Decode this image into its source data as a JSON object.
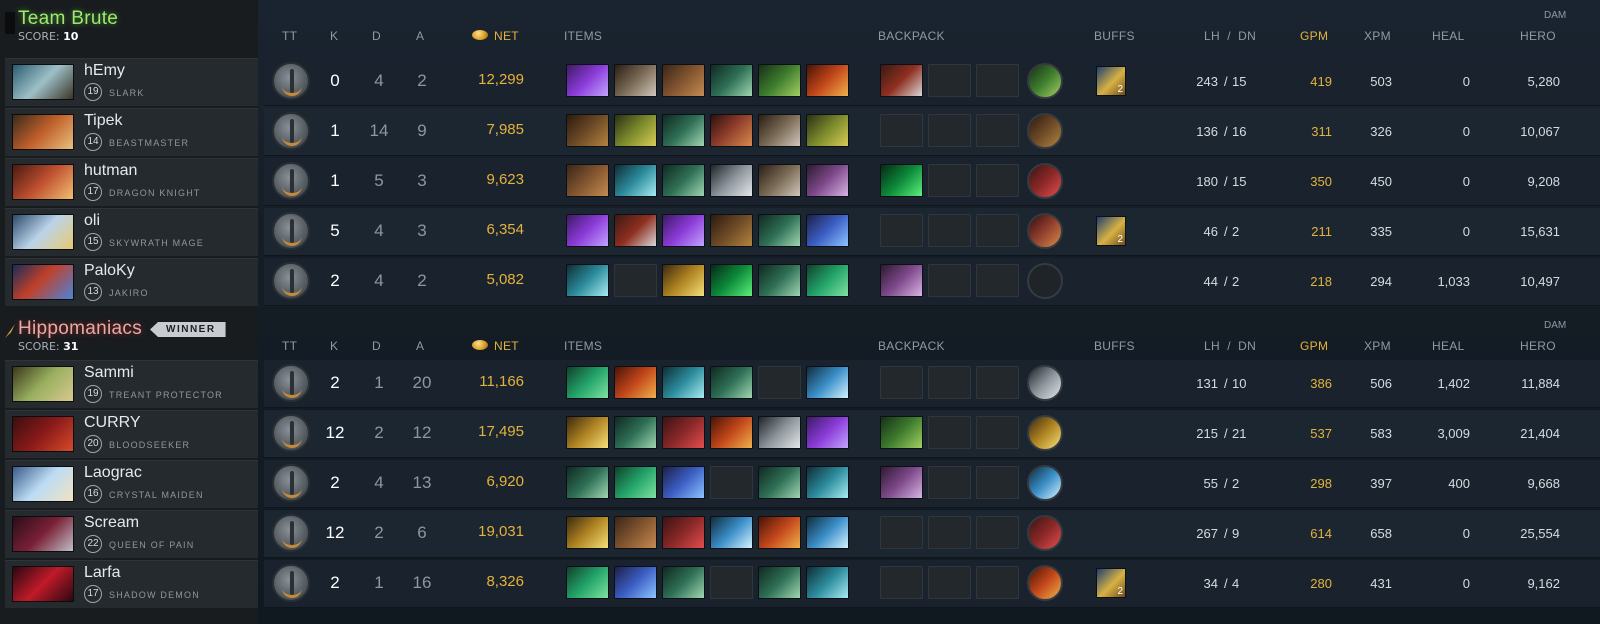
{
  "columns": {
    "tt": "TT",
    "k": "K",
    "d": "D",
    "a": "A",
    "net": "NET",
    "items": "ITEMS",
    "backpack": "BACKPACK",
    "buffs": "BUFFS",
    "lh_dn": "LH  /  DN",
    "gpm": "GPM",
    "xpm": "XPM",
    "heal": "HEAL",
    "dam": "DAM",
    "hero": "HERO"
  },
  "colors": {
    "team1": "#9ee873",
    "team2": "#e8a9a3",
    "gold": "#e3b23c"
  },
  "teams": [
    {
      "name": "Team Brute",
      "score_label": "SCORE:",
      "score": "10",
      "winner": "",
      "players": [
        {
          "name": "hEmy",
          "level": "19",
          "hero": "SLARK",
          "portrait": "p1",
          "k": "0",
          "d": "4",
          "a": "2",
          "net": "12,299",
          "items": [
            "g1",
            "g2",
            "g3",
            "g4",
            "g5",
            "g6"
          ],
          "backpack": [
            "g7",
            "",
            ""
          ],
          "neutral": "g5",
          "buff": "2",
          "lh": "243",
          "dn": "15",
          "gpm": "419",
          "xpm": "503",
          "heal": "0",
          "hero_dmg": "5,280"
        },
        {
          "name": "Tipek",
          "level": "14",
          "hero": "BEASTMASTER",
          "portrait": "p2",
          "k": "1",
          "d": "14",
          "a": "9",
          "net": "7,985",
          "items": [
            "g9",
            "g10",
            "g4",
            "g18",
            "g2",
            "g10"
          ],
          "backpack": [
            "",
            "",
            ""
          ],
          "neutral": "g9",
          "buff": "",
          "lh": "136",
          "dn": "16",
          "gpm": "311",
          "xpm": "326",
          "heal": "0",
          "hero_dmg": "10,067"
        },
        {
          "name": "hutman",
          "level": "17",
          "hero": "DRAGON KNIGHT",
          "portrait": "p3",
          "k": "1",
          "d": "5",
          "a": "3",
          "net": "9,623",
          "items": [
            "g3",
            "g11",
            "g4",
            "g12",
            "g2",
            "g16"
          ],
          "backpack": [
            "g15",
            "",
            ""
          ],
          "neutral": "g13",
          "buff": "",
          "lh": "180",
          "dn": "15",
          "gpm": "350",
          "xpm": "450",
          "heal": "0",
          "hero_dmg": "9,208"
        },
        {
          "name": "oli",
          "level": "15",
          "hero": "SKYWRATH MAGE",
          "portrait": "p4",
          "k": "5",
          "d": "4",
          "a": "3",
          "net": "6,354",
          "items": [
            "g1",
            "g7",
            "g1",
            "g9",
            "g4",
            "g14"
          ],
          "backpack": [
            "",
            "",
            ""
          ],
          "neutral": "g18",
          "buff": "2",
          "lh": "46",
          "dn": "2",
          "gpm": "211",
          "xpm": "335",
          "heal": "0",
          "hero_dmg": "15,631"
        },
        {
          "name": "PaloKy",
          "level": "13",
          "hero": "JAKIRO",
          "portrait": "p5",
          "k": "2",
          "d": "4",
          "a": "2",
          "net": "5,082",
          "items": [
            "g11",
            "",
            "g17",
            "g15",
            "g4",
            "g8"
          ],
          "backpack": [
            "g16",
            "",
            ""
          ],
          "neutral": "",
          "buff": "",
          "lh": "44",
          "dn": "2",
          "gpm": "218",
          "xpm": "294",
          "heal": "1,033",
          "hero_dmg": "10,497"
        }
      ]
    },
    {
      "name": "Hippomaniacs",
      "score_label": "SCORE:",
      "score": "31",
      "winner": "WINNER",
      "players": [
        {
          "name": "Sammi",
          "level": "19",
          "hero": "TREANT PROTECTOR",
          "portrait": "p6",
          "k": "2",
          "d": "1",
          "a": "20",
          "net": "11,166",
          "items": [
            "g8",
            "g6",
            "g11",
            "g4",
            "",
            "g19"
          ],
          "backpack": [
            "",
            "",
            ""
          ],
          "neutral": "g12",
          "buff": "",
          "lh": "131",
          "dn": "10",
          "gpm": "386",
          "xpm": "506",
          "heal": "1,402",
          "hero_dmg": "11,884"
        },
        {
          "name": "CURRY",
          "level": "20",
          "hero": "BLOODSEEKER",
          "portrait": "p7",
          "k": "12",
          "d": "2",
          "a": "12",
          "net": "17,495",
          "items": [
            "g17",
            "g4",
            "g13",
            "g6",
            "g12",
            "g1"
          ],
          "backpack": [
            "g5",
            "",
            ""
          ],
          "neutral": "g17",
          "buff": "",
          "lh": "215",
          "dn": "21",
          "gpm": "537",
          "xpm": "583",
          "heal": "3,009",
          "hero_dmg": "21,404"
        },
        {
          "name": "Laograc",
          "level": "16",
          "hero": "CRYSTAL MAIDEN",
          "portrait": "p8",
          "k": "2",
          "d": "4",
          "a": "13",
          "net": "6,920",
          "items": [
            "g4",
            "g8",
            "g14",
            "",
            "g4",
            "g11"
          ],
          "backpack": [
            "g16",
            "",
            ""
          ],
          "neutral": "g19",
          "buff": "",
          "lh": "55",
          "dn": "2",
          "gpm": "298",
          "xpm": "397",
          "heal": "400",
          "hero_dmg": "9,668"
        },
        {
          "name": "Scream",
          "level": "22",
          "hero": "QUEEN OF PAIN",
          "portrait": "p9",
          "k": "12",
          "d": "2",
          "a": "6",
          "net": "19,031",
          "items": [
            "g17",
            "g3",
            "g13",
            "g19",
            "g6",
            "g19"
          ],
          "backpack": [
            "",
            "",
            ""
          ],
          "neutral": "g13",
          "buff": "",
          "lh": "267",
          "dn": "9",
          "gpm": "614",
          "xpm": "658",
          "heal": "0",
          "hero_dmg": "25,554"
        },
        {
          "name": "Larfa",
          "level": "17",
          "hero": "SHADOW DEMON",
          "portrait": "p10",
          "k": "2",
          "d": "1",
          "a": "16",
          "net": "8,326",
          "items": [
            "g8",
            "g14",
            "g4",
            "",
            "g4",
            "g11"
          ],
          "backpack": [
            "",
            "",
            ""
          ],
          "neutral": "g6",
          "buff": "2",
          "lh": "34",
          "dn": "4",
          "gpm": "280",
          "xpm": "431",
          "heal": "0",
          "hero_dmg": "9,162"
        }
      ]
    }
  ]
}
